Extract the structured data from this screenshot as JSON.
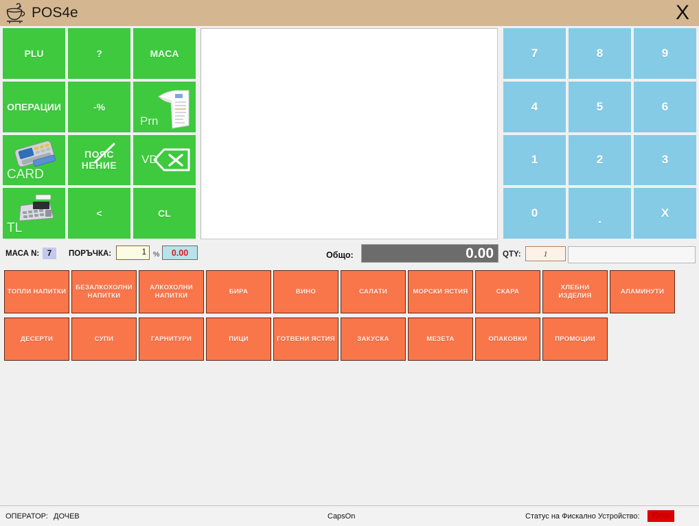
{
  "window": {
    "title": "POS4e",
    "logo_icon": "coffee-cup-icon",
    "close_label": "X"
  },
  "function_keys": [
    {
      "label": "PLU",
      "icon": "",
      "style": "plain"
    },
    {
      "label": "?",
      "icon": "",
      "style": "plain"
    },
    {
      "label": "MACA",
      "icon": "",
      "style": "plain"
    },
    {
      "label": "ОПЕРАЦИИ",
      "icon": "",
      "style": "plain"
    },
    {
      "label": "-%",
      "icon": "",
      "style": "plain"
    },
    {
      "label": "Prn",
      "icon": "receipt-icon",
      "style": "prn"
    },
    {
      "label": "CARD",
      "icon": "card-terminal-icon",
      "style": "corner-bl"
    },
    {
      "label": "ПОЯС НЕНИЕ",
      "icon": "slash-icon",
      "style": "expl"
    },
    {
      "label": "VD",
      "icon": "void-x-icon",
      "style": "vd"
    },
    {
      "label": "TL",
      "icon": "cash-register-icon",
      "style": "corner-bl"
    },
    {
      "label": "<",
      "icon": "",
      "style": "plain"
    },
    {
      "label": "CL",
      "icon": "",
      "style": "plain"
    }
  ],
  "numeric_keys": [
    "7",
    "8",
    "9",
    "4",
    "5",
    "6",
    "1",
    "2",
    "3",
    "0",
    ".",
    "X"
  ],
  "infobar": {
    "table_label": "МАСА N:",
    "table_value": "7",
    "order_label": "ПОРЪЧКА:",
    "order_value": "1",
    "percent_sign": "%",
    "percent_value": "0.00",
    "total_label": "Общо:",
    "total_value": "0.00",
    "qty_label": "QTY:",
    "qty_value": "1",
    "free_input_value": ""
  },
  "categories_row1": [
    "ТОПЛИ НАПИТКИ",
    "БЕЗАЛКОХОЛНИ НАПИТКИ",
    "АЛКОХОЛНИ НАПИТКИ",
    "БИРА",
    "ВИНО",
    "САЛАТИ",
    "МОРСКИ ЯСТИЯ",
    "СКАРА",
    "ХЛЕБНИ ИЗДЕЛИЯ",
    "АЛАМИНУТИ"
  ],
  "categories_row2": [
    "ДЕСЕРТИ",
    "СУПИ",
    "ГАРНИТУРИ",
    "ПИЦИ",
    "ГОТВЕНИ ЯСТИЯ",
    "ЗАКУСКА",
    "МЕЗЕТА",
    "ОПАКОВКИ",
    "ПРОМОЦИИ"
  ],
  "statusbar": {
    "operator_label": "ОПЕРАТОР:",
    "operator_value": "ДОЧЕВ",
    "caps": "CapsOn",
    "fiscal_label": "Статус на Фискално Устройство:",
    "fiscal_status": "Error"
  },
  "colors": {
    "titlebar": "#d4b791",
    "function_key": "#3ec93e",
    "numeric_key": "#85cbe6",
    "category_key": "#f9764b",
    "total_box": "#6c6c6c",
    "error_badge": "#e00000"
  }
}
